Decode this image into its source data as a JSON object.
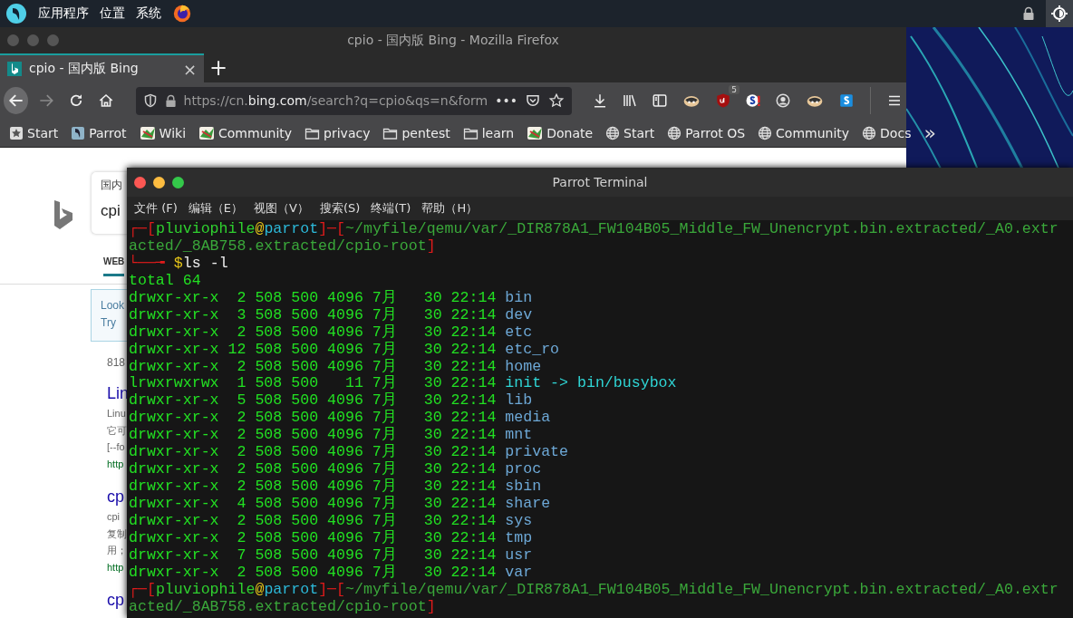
{
  "top_bar": {
    "menus": [
      "应用程序",
      "位置",
      "系统"
    ]
  },
  "browser": {
    "title": "cpio - 国内版 Bing - Mozilla Firefox",
    "tabs": [
      {
        "label": "cpio - 国内版 Bing",
        "selected": true,
        "close": "×"
      }
    ],
    "new_tab": "+",
    "nav_buttons": [
      {
        "kind": "back",
        "disabled": false
      },
      {
        "kind": "forward",
        "disabled": true
      },
      {
        "kind": "reload",
        "disabled": false
      },
      {
        "kind": "home",
        "disabled": false
      }
    ],
    "url": {
      "prefix": "https://cn.",
      "domain": "bing.com",
      "rest": "/search?q=cpio&qs=n&form"
    },
    "url_more": "•••",
    "toolbar_badge": "5",
    "bookmarks": [
      {
        "label": "Start",
        "kind": "star"
      },
      {
        "label": "Parrot",
        "kind": "parrot"
      },
      {
        "label": "Wiki",
        "kind": "wiki"
      },
      {
        "label": "Community",
        "kind": "wiki"
      },
      {
        "label": "privacy",
        "kind": "folder"
      },
      {
        "label": "pentest",
        "kind": "folder"
      },
      {
        "label": "learn",
        "kind": "folder"
      },
      {
        "label": "Donate",
        "kind": "wiki"
      },
      {
        "label": "Start",
        "kind": "globe"
      },
      {
        "label": "Parrot OS",
        "kind": "globe"
      },
      {
        "label": "Community",
        "kind": "globe"
      },
      {
        "label": "Docs",
        "kind": "globe"
      }
    ],
    "bookmarks_more": "»",
    "page": {
      "search_scope": "国内",
      "search_value": "cpi",
      "tab": "WEB",
      "notice": [
        "Look",
        "Try"
      ],
      "count": "818",
      "results": [
        {
          "title": "Lin",
          "lines": [
            "Linu",
            "它可",
            "[--fo"
          ],
          "url": "http"
        },
        {
          "title": "cp",
          "lines": [
            "cpi",
            "复制",
            "用；"
          ],
          "url": "http"
        },
        {
          "title": "cp"
        }
      ]
    }
  },
  "terminal": {
    "title": "Parrot Terminal",
    "menus": [
      "文件 (F)",
      "编辑（E）",
      "视图（V）",
      "搜索(S)",
      "终端(T)",
      "帮助（H）"
    ],
    "prompts": [
      {
        "open": "┌─[",
        "user": "pluviophile",
        "at": "@",
        "host": "parrot",
        "mid": "]─[",
        "path_lines": [
          "~/myfile/qemu/var/_DIR878A1_FW104B05_Middle_FW_Unencrypt.bin.extracted/_A0.extr",
          "acted/_8AB758.extracted/cpio-root"
        ],
        "close": "]"
      },
      {
        "open": "┌─[",
        "user": "pluviophile",
        "at": "@",
        "host": "parrot",
        "mid": "]─[",
        "path_lines": [
          "~/myfile/qemu/var/_DIR878A1_FW104B05_Middle_FW_Unencrypt.bin.extracted/_A0.extr",
          "acted/_8AB758.extracted/cpio-root"
        ],
        "close": "]"
      }
    ],
    "corner": "└──╼ ",
    "symbol": "$",
    "command": "ls -l",
    "total": "total 64",
    "entries": [
      {
        "mode": "drwxr-xr-x",
        "links": "2",
        "user": "508",
        "group": "500",
        "size": "4096",
        "month": "7月",
        "day": "30",
        "time": "22:14",
        "name": "bin",
        "kind": "dir"
      },
      {
        "mode": "drwxr-xr-x",
        "links": "3",
        "user": "508",
        "group": "500",
        "size": "4096",
        "month": "7月",
        "day": "30",
        "time": "22:14",
        "name": "dev",
        "kind": "dir"
      },
      {
        "mode": "drwxr-xr-x",
        "links": "2",
        "user": "508",
        "group": "500",
        "size": "4096",
        "month": "7月",
        "day": "30",
        "time": "22:14",
        "name": "etc",
        "kind": "dir"
      },
      {
        "mode": "drwxr-xr-x",
        "links": "12",
        "user": "508",
        "group": "500",
        "size": "4096",
        "month": "7月",
        "day": "30",
        "time": "22:14",
        "name": "etc_ro",
        "kind": "dir"
      },
      {
        "mode": "drwxr-xr-x",
        "links": "2",
        "user": "508",
        "group": "500",
        "size": "4096",
        "month": "7月",
        "day": "30",
        "time": "22:14",
        "name": "home",
        "kind": "dir"
      },
      {
        "mode": "lrwxrwxrwx",
        "links": "1",
        "user": "508",
        "group": "500",
        "size": "11",
        "month": "7月",
        "day": "30",
        "time": "22:14",
        "name": "init -> bin/busybox",
        "kind": "link"
      },
      {
        "mode": "drwxr-xr-x",
        "links": "5",
        "user": "508",
        "group": "500",
        "size": "4096",
        "month": "7月",
        "day": "30",
        "time": "22:14",
        "name": "lib",
        "kind": "dir"
      },
      {
        "mode": "drwxr-xr-x",
        "links": "2",
        "user": "508",
        "group": "500",
        "size": "4096",
        "month": "7月",
        "day": "30",
        "time": "22:14",
        "name": "media",
        "kind": "dir"
      },
      {
        "mode": "drwxr-xr-x",
        "links": "2",
        "user": "508",
        "group": "500",
        "size": "4096",
        "month": "7月",
        "day": "30",
        "time": "22:14",
        "name": "mnt",
        "kind": "dir"
      },
      {
        "mode": "drwxr-xr-x",
        "links": "2",
        "user": "508",
        "group": "500",
        "size": "4096",
        "month": "7月",
        "day": "30",
        "time": "22:14",
        "name": "private",
        "kind": "dir"
      },
      {
        "mode": "drwxr-xr-x",
        "links": "2",
        "user": "508",
        "group": "500",
        "size": "4096",
        "month": "7月",
        "day": "30",
        "time": "22:14",
        "name": "proc",
        "kind": "dir"
      },
      {
        "mode": "drwxr-xr-x",
        "links": "2",
        "user": "508",
        "group": "500",
        "size": "4096",
        "month": "7月",
        "day": "30",
        "time": "22:14",
        "name": "sbin",
        "kind": "dir"
      },
      {
        "mode": "drwxr-xr-x",
        "links": "4",
        "user": "508",
        "group": "500",
        "size": "4096",
        "month": "7月",
        "day": "30",
        "time": "22:14",
        "name": "share",
        "kind": "dir"
      },
      {
        "mode": "drwxr-xr-x",
        "links": "2",
        "user": "508",
        "group": "500",
        "size": "4096",
        "month": "7月",
        "day": "30",
        "time": "22:14",
        "name": "sys",
        "kind": "dir"
      },
      {
        "mode": "drwxr-xr-x",
        "links": "2",
        "user": "508",
        "group": "500",
        "size": "4096",
        "month": "7月",
        "day": "30",
        "time": "22:14",
        "name": "tmp",
        "kind": "dir"
      },
      {
        "mode": "drwxr-xr-x",
        "links": "7",
        "user": "508",
        "group": "500",
        "size": "4096",
        "month": "7月",
        "day": "30",
        "time": "22:14",
        "name": "usr",
        "kind": "dir"
      },
      {
        "mode": "drwxr-xr-x",
        "links": "2",
        "user": "508",
        "group": "500",
        "size": "4096",
        "month": "7月",
        "day": "30",
        "time": "22:14",
        "name": "var",
        "kind": "dir"
      }
    ]
  }
}
